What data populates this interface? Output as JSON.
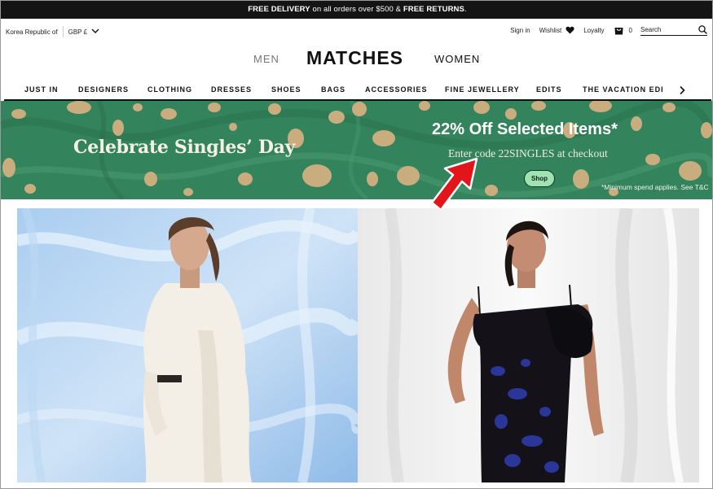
{
  "promo": {
    "part1": "FREE DELIVERY",
    "part2": " on all orders over $500 & ",
    "part3": "FREE RETURNS",
    "part4": "."
  },
  "locale": {
    "country": "Korea Republic of",
    "currency": "GBP £"
  },
  "account": {
    "sign_in": "Sign in",
    "wishlist": "Wishlist",
    "loyalty": "Loyalty",
    "bag_count": "0",
    "search_placeholder": "Search"
  },
  "brand": {
    "men": "MEN",
    "logo": "MATCHES",
    "women": "WOMEN"
  },
  "categories": [
    "JUST IN",
    "DESIGNERS",
    "CLOTHING",
    "DRESSES",
    "SHOES",
    "BAGS",
    "ACCESSORIES",
    "FINE JEWELLERY",
    "EDITS",
    "THE VACATION EDIT"
  ],
  "banner": {
    "title": "Celebrate Singles’ Day",
    "offer": "22% Off Selected Items*",
    "code_line": "Enter code 22SINGLES at checkout",
    "shop_label": "Shop",
    "terms": "*Minimum spend applies. See T&C",
    "bg_color": "#33845c",
    "spot_color": "#c9ad7f"
  },
  "colors": {
    "promo_bar": "#141414",
    "shop_button": "#9fe3b3",
    "annotation_arrow": "#e4141b"
  }
}
